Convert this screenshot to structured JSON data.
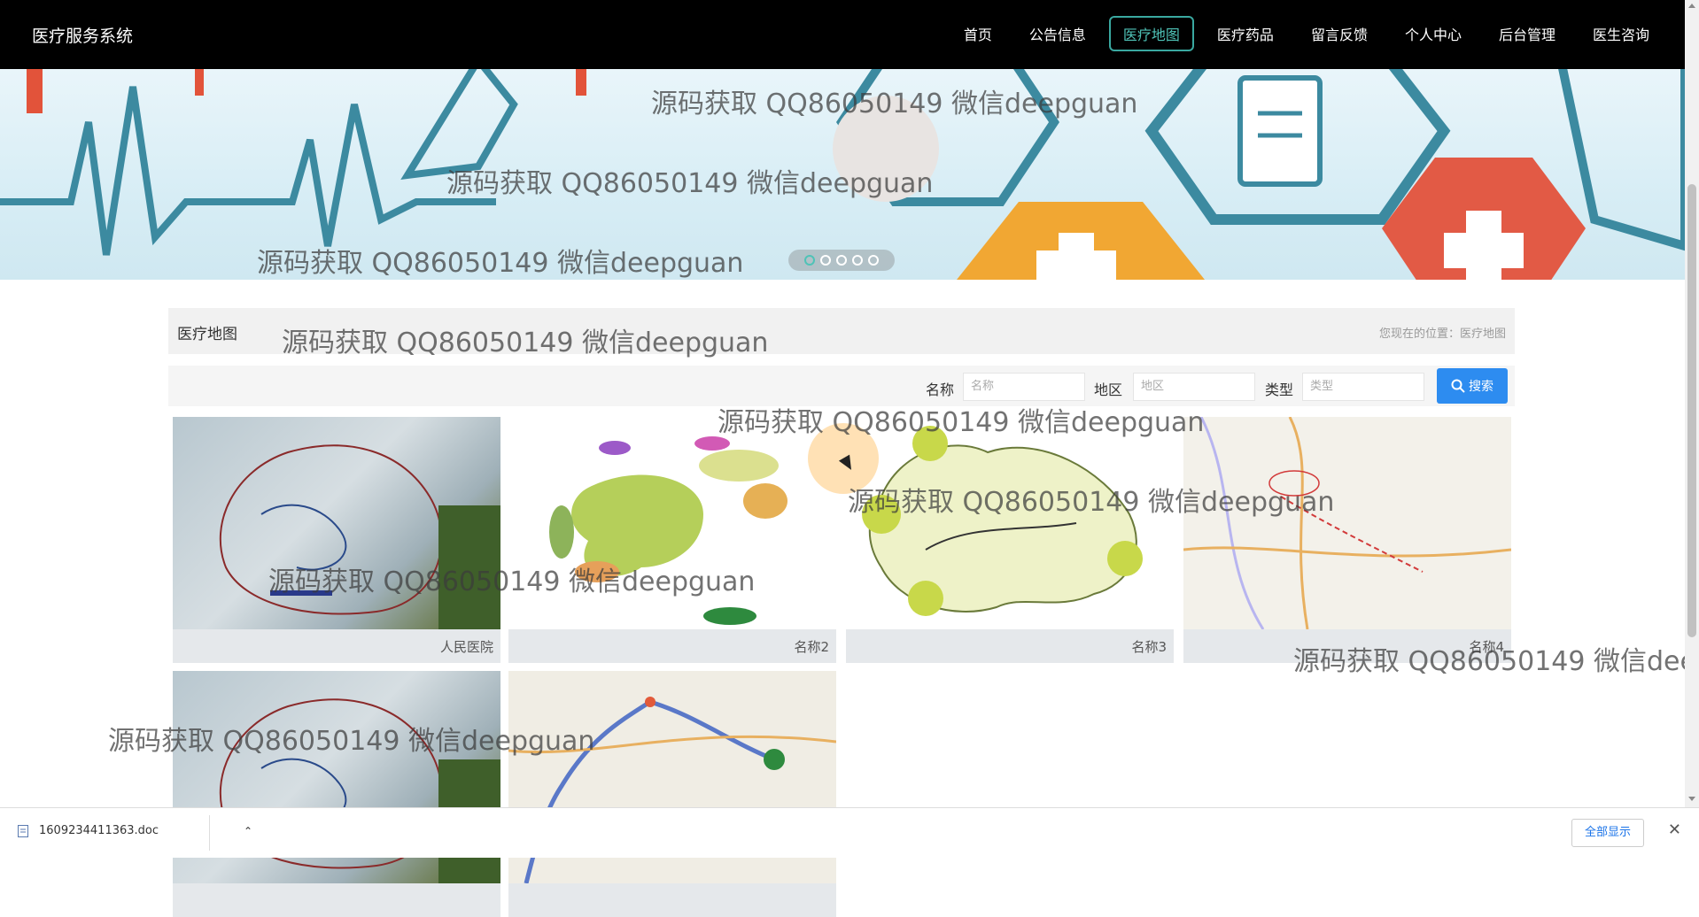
{
  "brand": "医疗服务系统",
  "nav": [
    {
      "label": "首页"
    },
    {
      "label": "公告信息"
    },
    {
      "label": "医疗地图",
      "active": true
    },
    {
      "label": "医疗药品"
    },
    {
      "label": "留言反馈"
    },
    {
      "label": "个人中心"
    },
    {
      "label": "后台管理"
    },
    {
      "label": "医生咨询"
    }
  ],
  "carousel": {
    "slide_count": 5,
    "active_index": 0
  },
  "watermark": "源码获取 QQ86050149 微信deepguan",
  "section": {
    "title": "医疗地图",
    "location": "您现在的位置：医疗地图"
  },
  "search": {
    "name_label": "名称",
    "name_placeholder": "名称",
    "region_label": "地区",
    "region_placeholder": "地区",
    "type_label": "类型",
    "type_placeholder": "类型",
    "button_label": "搜索"
  },
  "cards": [
    {
      "caption": "人民医院"
    },
    {
      "caption": "名称2"
    },
    {
      "caption": "名称3"
    },
    {
      "caption": "名称4"
    },
    {
      "caption": ""
    },
    {
      "caption": ""
    }
  ],
  "download": {
    "filename": "1609234411363.doc",
    "show_all": "全部显示"
  },
  "colors": {
    "nav_active": "#3aa8a0",
    "search_button": "#2d8cf0",
    "banner_bg": "#d7edf5"
  }
}
